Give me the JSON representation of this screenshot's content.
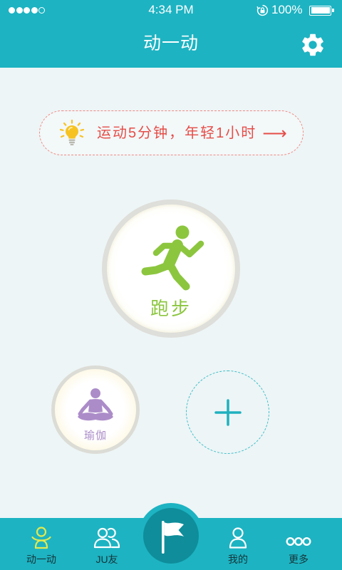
{
  "status_bar": {
    "signal": {
      "icon": "signal-dots-icon",
      "level": 4,
      "max": 5
    },
    "time": "4:34 PM",
    "rotation_lock_icon": "rotation-lock-icon",
    "battery_percent": "100%",
    "battery": {
      "icon": "battery-icon",
      "level": 1.0
    }
  },
  "header": {
    "title": "动一动",
    "settings_icon": "gear-icon"
  },
  "tip_banner": {
    "icon": "lightbulb-icon",
    "text": "运动5分钟，年轻1小时",
    "arrow": "⟶"
  },
  "activities": [
    {
      "label": "跑步",
      "icon": "runner-icon"
    },
    {
      "label": "瑜伽",
      "icon": "yoga-icon"
    }
  ],
  "add_activity": {
    "icon": "plus-icon"
  },
  "tab_bar": {
    "tabs": [
      {
        "label": "动一动",
        "icon": "person-icon",
        "active": true
      },
      {
        "label": "JU友",
        "icon": "friends-icon",
        "active": false
      },
      {
        "label": "我的",
        "icon": "profile-icon",
        "active": false
      },
      {
        "label": "更多",
        "icon": "more-circles-icon",
        "active": false
      }
    ],
    "center_button": {
      "icon": "flag-icon"
    }
  },
  "colors": {
    "primary": "#1db3c2",
    "primary_dark": "#0f8d9a",
    "background": "#edf5f6",
    "tip_text": "#e54d48",
    "tip_border": "#ef8a84",
    "active_tab_icon": "#e4e94c",
    "running": "#8cc63f",
    "yoga": "#ab8cc8",
    "tab_text": "#16353a",
    "bulb": "#f6c323",
    "add_button": "#1fb1bf"
  }
}
